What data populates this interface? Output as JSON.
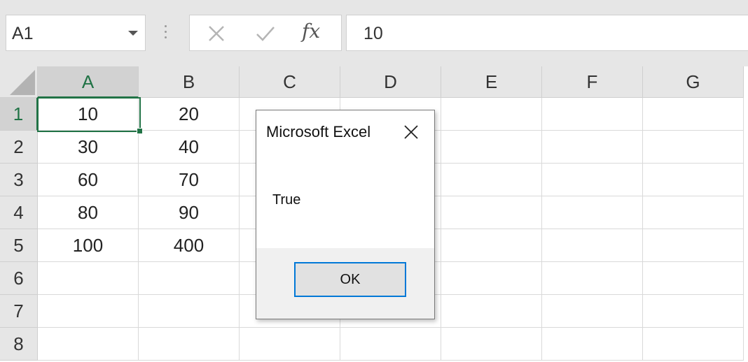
{
  "name_box": {
    "value": "A1"
  },
  "formula_bar": {
    "value": "10",
    "fx_label": "fx"
  },
  "columns": [
    "A",
    "B",
    "C",
    "D",
    "E",
    "F",
    "G"
  ],
  "rows": [
    "1",
    "2",
    "3",
    "4",
    "5",
    "6",
    "7",
    "8"
  ],
  "cells": {
    "A1": "10",
    "B1": "20",
    "A2": "30",
    "B2": "40",
    "A3": "60",
    "B3": "70",
    "A4": "80",
    "B4": "90",
    "A5": "100",
    "B5": "400"
  },
  "selected_cell": "A1",
  "dialog": {
    "title": "Microsoft Excel",
    "message": "True",
    "ok_label": "OK"
  },
  "colors": {
    "accent": "#217346",
    "dialog_focus": "#0078d7"
  }
}
